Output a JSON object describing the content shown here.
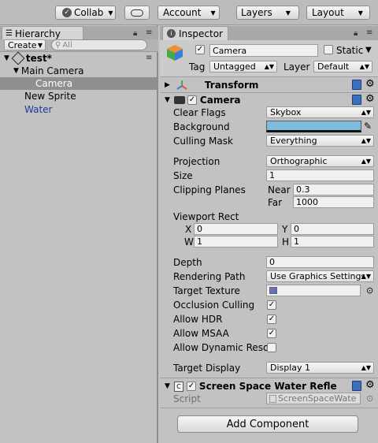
{
  "toolbar": {
    "collab": "Collab",
    "account": "Account",
    "layers": "Layers",
    "layout": "Layout"
  },
  "hierarchy": {
    "tab": "Hierarchy",
    "create": "Create",
    "search_placeholder": "All",
    "scene": "test*",
    "items": [
      "Main Camera",
      "Camera",
      "New Sprite",
      "Water"
    ]
  },
  "inspector": {
    "tab": "Inspector",
    "object_name": "Camera",
    "static_label": "Static",
    "tag_label": "Tag",
    "tag_value": "Untagged",
    "layer_label": "Layer",
    "layer_value": "Default",
    "transform_title": "Transform",
    "camera_title": "Camera",
    "fields": {
      "clear_flags": {
        "label": "Clear Flags",
        "value": "Skybox"
      },
      "background": {
        "label": "Background",
        "color": "#7fbcdc"
      },
      "culling_mask": {
        "label": "Culling Mask",
        "value": "Everything"
      },
      "projection": {
        "label": "Projection",
        "value": "Orthographic"
      },
      "size": {
        "label": "Size",
        "value": "1"
      },
      "clipping": {
        "label": "Clipping Planes",
        "near_label": "Near",
        "near": "0.3",
        "far_label": "Far",
        "far": "1000"
      },
      "viewport": {
        "label": "Viewport Rect",
        "x_label": "X",
        "x": "0",
        "y_label": "Y",
        "y": "0",
        "w_label": "W",
        "w": "1",
        "h_label": "H",
        "h": "1"
      },
      "depth": {
        "label": "Depth",
        "value": "0"
      },
      "rendering_path": {
        "label": "Rendering Path",
        "value": "Use Graphics Settings"
      },
      "target_texture": {
        "label": "Target Texture"
      },
      "occlusion_culling": {
        "label": "Occlusion Culling",
        "checked": true
      },
      "allow_hdr": {
        "label": "Allow HDR",
        "checked": true
      },
      "allow_msaa": {
        "label": "Allow MSAA",
        "checked": true
      },
      "allow_dynamic": {
        "label": "Allow Dynamic Reso",
        "checked": false
      },
      "target_display": {
        "label": "Target Display",
        "value": "Display 1"
      }
    },
    "script_component": {
      "title": "Screen Space Water Refle",
      "script_label": "Script",
      "script_value": "ScreenSpaceWate"
    },
    "add_component": "Add Component"
  }
}
